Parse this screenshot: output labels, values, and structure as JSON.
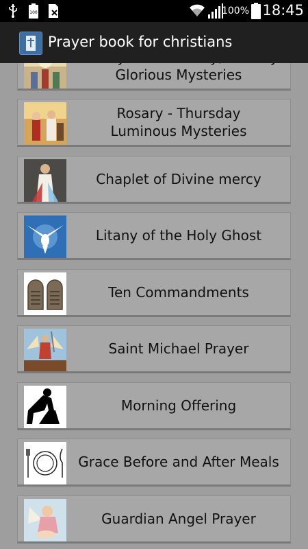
{
  "status_bar": {
    "battery_percent": "100%",
    "time": "18:45",
    "icons": [
      "usb-icon",
      "battery-100-icon",
      "sim-disabled-icon",
      "wifi-icon",
      "signal-icon",
      "battery-icon"
    ]
  },
  "app_bar": {
    "title": "Prayer book for christians",
    "icon": "prayer-book-app-icon"
  },
  "list": {
    "items": [
      {
        "label": "Rosary - Wednesday, Sunday\nGlorious Mysteries",
        "thumb": "glorious-mysteries-image"
      },
      {
        "label": "Rosary - Thursday\nLuminous Mysteries",
        "thumb": "luminous-mysteries-image"
      },
      {
        "label": "Chaplet of Divine mercy",
        "thumb": "divine-mercy-image"
      },
      {
        "label": "Litany of the Holy Ghost",
        "thumb": "holy-ghost-dove-image"
      },
      {
        "label": "Ten Commandments",
        "thumb": "stone-tablets-image"
      },
      {
        "label": "Saint Michael Prayer",
        "thumb": "saint-michael-image"
      },
      {
        "label": "Morning Offering",
        "thumb": "kneeling-figure-image"
      },
      {
        "label": "Grace Before and After Meals",
        "thumb": "plate-cutlery-image"
      },
      {
        "label": "Guardian Angel Prayer",
        "thumb": "guardian-angel-image"
      }
    ]
  }
}
